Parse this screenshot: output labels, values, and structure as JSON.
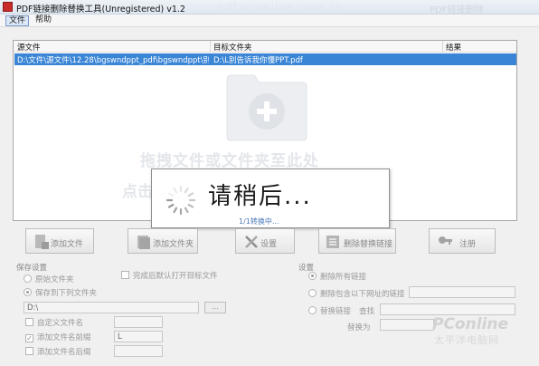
{
  "window": {
    "title": "PDF链接删除替换工具(Unregistered) v1.2",
    "watermark_top": "pdf.pconline.com.cn",
    "watermark_right": "PDF链接删除"
  },
  "menu": {
    "items": [
      {
        "label": "文件"
      },
      {
        "label": "帮助"
      }
    ]
  },
  "file_list": {
    "columns": [
      "源文件",
      "目标文件夹",
      "结果"
    ],
    "rows": [
      {
        "source": "D:\\文件\\源文件\\12.28\\bgswndppt_pdf\\bgswndppt\\别告诉...",
        "target": "D:\\L别告诉我你懂PPT.pdf",
        "result": ""
      }
    ]
  },
  "drop_zone": {
    "hint": "拖拽文件或文件夹至此处",
    "hint2": "点击"
  },
  "progress": {
    "title": "请稍后...",
    "subtitle": "1/1转换中..."
  },
  "toolbar": {
    "add_file": "添加文件",
    "add_folder": "添加文件夹",
    "settings": "设置",
    "delete_replace": "删除替换链接",
    "register": "注册"
  },
  "save_settings": {
    "title": "保存设置",
    "original_folder": "原始文件夹",
    "save_to_folder": "保存到下列文件夹",
    "open_after": "完成后默认打开目标文件",
    "folder_path": "D:\\",
    "browse": "...",
    "custom_name": "自定义文件名",
    "add_prefix": "添加文件名前缀",
    "prefix_value": "L",
    "add_suffix": "添加文件名后缀"
  },
  "link_settings": {
    "title": "设置",
    "delete_all": "删除所有链接",
    "delete_containing": "删除包含以下网址的链接",
    "replace_link": "替换链接",
    "find": "查找",
    "replace_with": "替换为"
  },
  "watermark": {
    "brand": "PConline",
    "brand_sub": "太平洋电脑网"
  }
}
